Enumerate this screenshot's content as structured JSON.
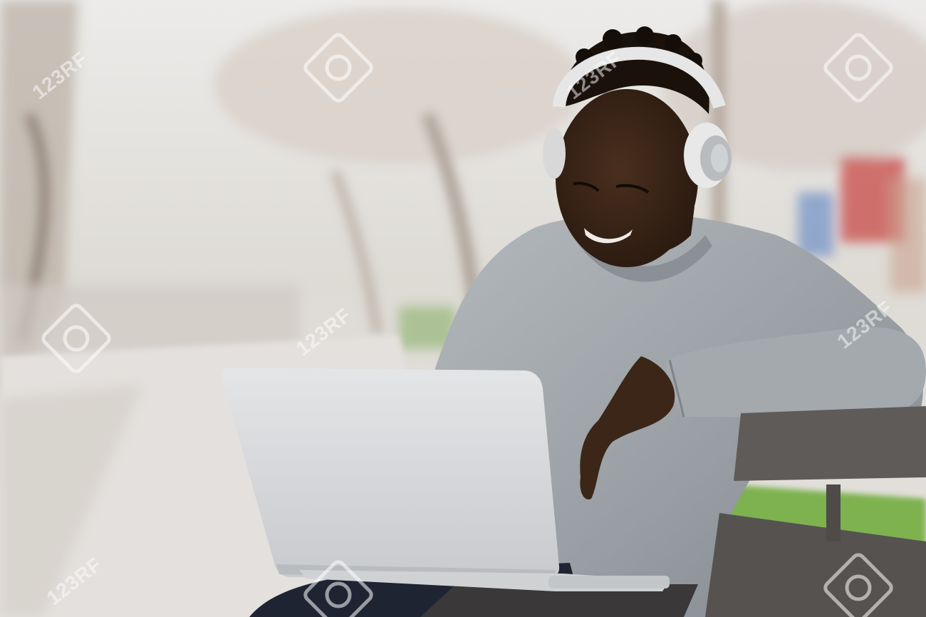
{
  "photo": {
    "subject": "man-with-headphones-using-laptop-on-bench",
    "colors": {
      "sky": "#e9e6e2",
      "path": "#e2dfdc",
      "grass": "#7fb352",
      "sweater": "#9aa0a5",
      "skin": "#3a2518",
      "laptop": "#d7d9dc",
      "bench": "#5e5a58",
      "headphones": "#e5e5e5",
      "jeans": "#1f2433"
    }
  },
  "watermark": {
    "text": "123RF",
    "icon": "camera-lens-icon"
  }
}
